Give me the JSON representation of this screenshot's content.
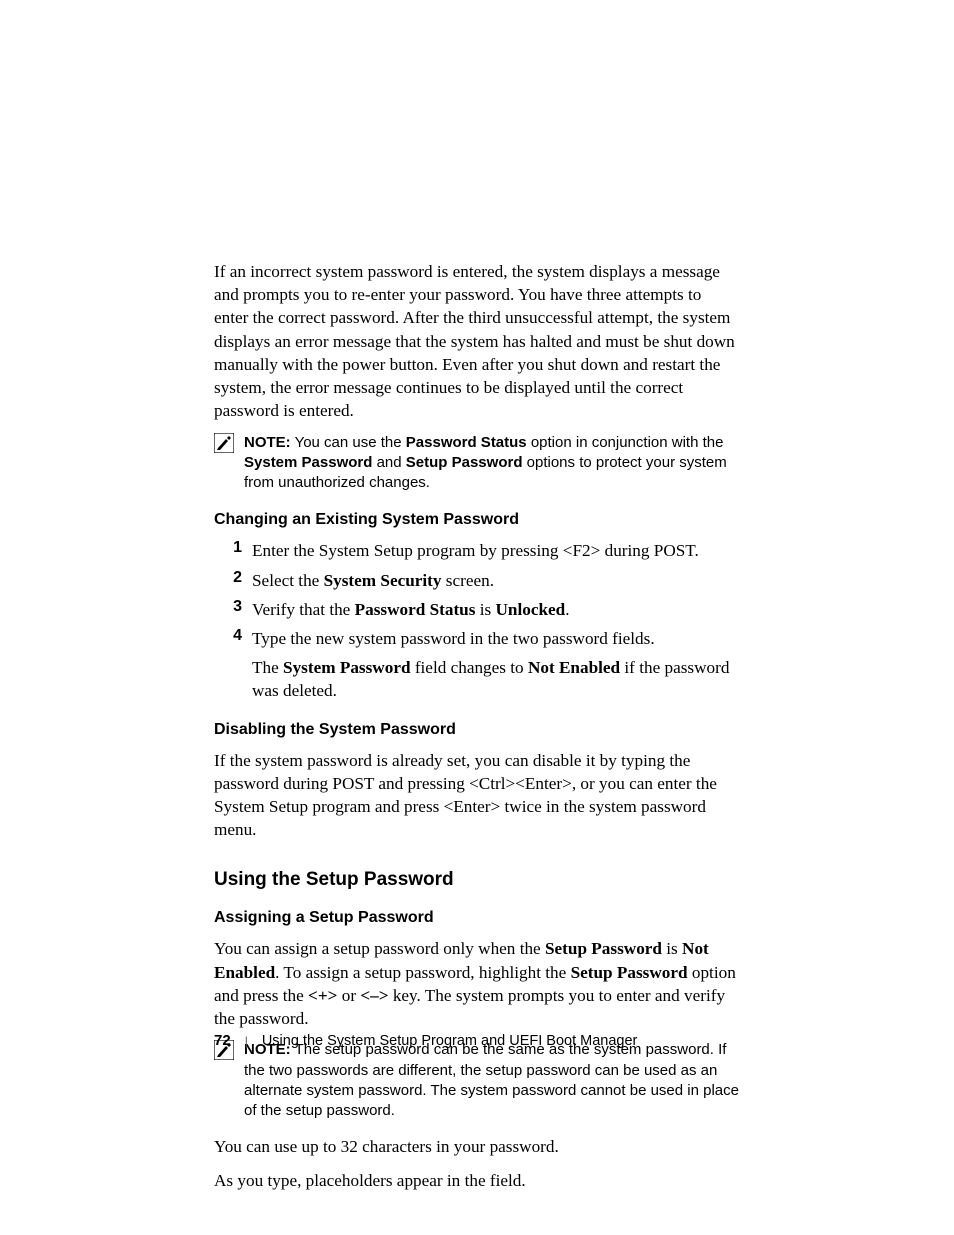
{
  "intro_paragraph": "If an incorrect system password is entered, the system displays a message and prompts you to re-enter your password. You have three attempts to enter the correct password. After the third unsuccessful attempt, the system displays an error message that the system has halted and must be shut down manually with the power button. Even after you shut down and restart the system, the error message continues to be displayed until the correct password is entered.",
  "note1": {
    "label": "NOTE:",
    "pre": " You can use the ",
    "b1": "Password Status",
    "mid1": " option in conjunction with the ",
    "b2": "System Password",
    "mid2": " and ",
    "b3": "Setup Password",
    "post": " options to protect your system from unauthorized changes."
  },
  "h4a": "Changing an Existing System Password",
  "steps": {
    "s1": "Enter the System Setup program by pressing <F2> during POST.",
    "s2_pre": "Select the ",
    "s2_b": "System Security",
    "s2_post": " screen.",
    "s3_pre": "Verify that the ",
    "s3_b1": "Password Status",
    "s3_mid": " is ",
    "s3_b2": "Unlocked",
    "s3_post": ".",
    "s4": "Type the new system password in the two password fields.",
    "s4b_pre": "The ",
    "s4b_b1": "System Password",
    "s4b_mid": " field changes to ",
    "s4b_b2": "Not Enabled",
    "s4b_post": " if the password was deleted."
  },
  "h4b": "Disabling the System Password",
  "disable_paragraph": "If the system password is already set, you can disable it by typing the password during POST and pressing <Ctrl><Enter>, or you can enter the System Setup program and press <Enter> twice in the system password menu.",
  "h3": "Using the Setup Password",
  "h4c": "Assigning a Setup Password",
  "assign": {
    "pre": "You can assign a setup password only when the ",
    "b1": "Setup Password",
    "mid1": " is ",
    "b2": "Not Enabled",
    "mid2": ". To assign a setup password, highlight the ",
    "b3": "Setup Password",
    "mid3": " option and press the ",
    "b4": "<+>",
    "mid4": " or ",
    "b5": "<–>",
    "post": " key. The system prompts you to enter and verify the password."
  },
  "note2": {
    "label": "NOTE:",
    "text": " The setup password can be the same as the system password. If the two passwords are different, the setup password can be used as an alternate system password. The system password cannot be used in place of the setup password."
  },
  "para_chars": "You can use up to 32 characters in your password.",
  "para_placeholders": "As you type, placeholders appear in the field.",
  "footer": {
    "page": "72",
    "title": "Using the System Setup Program and UEFI Boot Manager"
  }
}
